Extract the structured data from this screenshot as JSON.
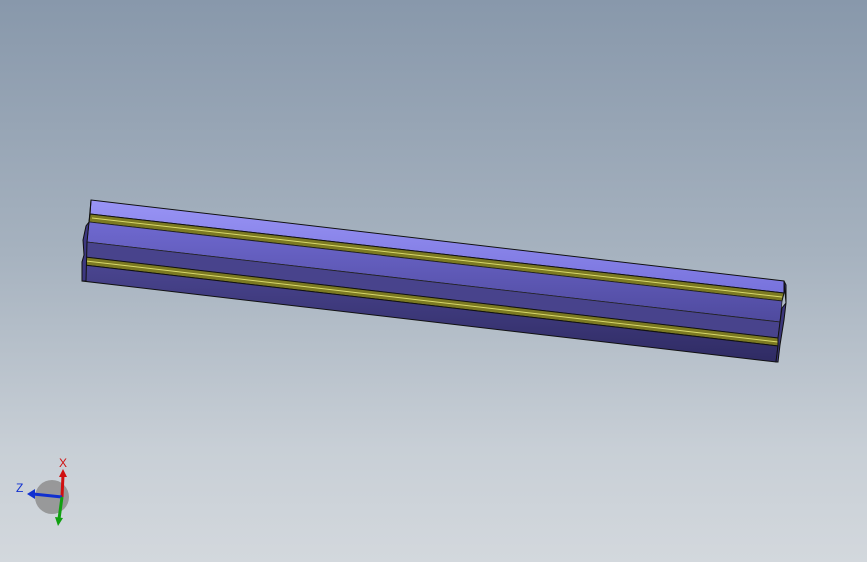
{
  "viewport": {
    "background_top": "#8898ab",
    "background_bottom": "#d3d8dd"
  },
  "model": {
    "part": "extruded-aluminum-profile",
    "colors": {
      "face_light": "#8a86ee",
      "face_mid": "#5f5ab8",
      "face_dark": "#3b367a",
      "slot": "#7a7a1a",
      "edge": "#111111"
    }
  },
  "triad": {
    "x_label": "X",
    "z_label": "Z",
    "x_color": "#d01010",
    "y_color": "#10a010",
    "z_color": "#1030d0"
  }
}
